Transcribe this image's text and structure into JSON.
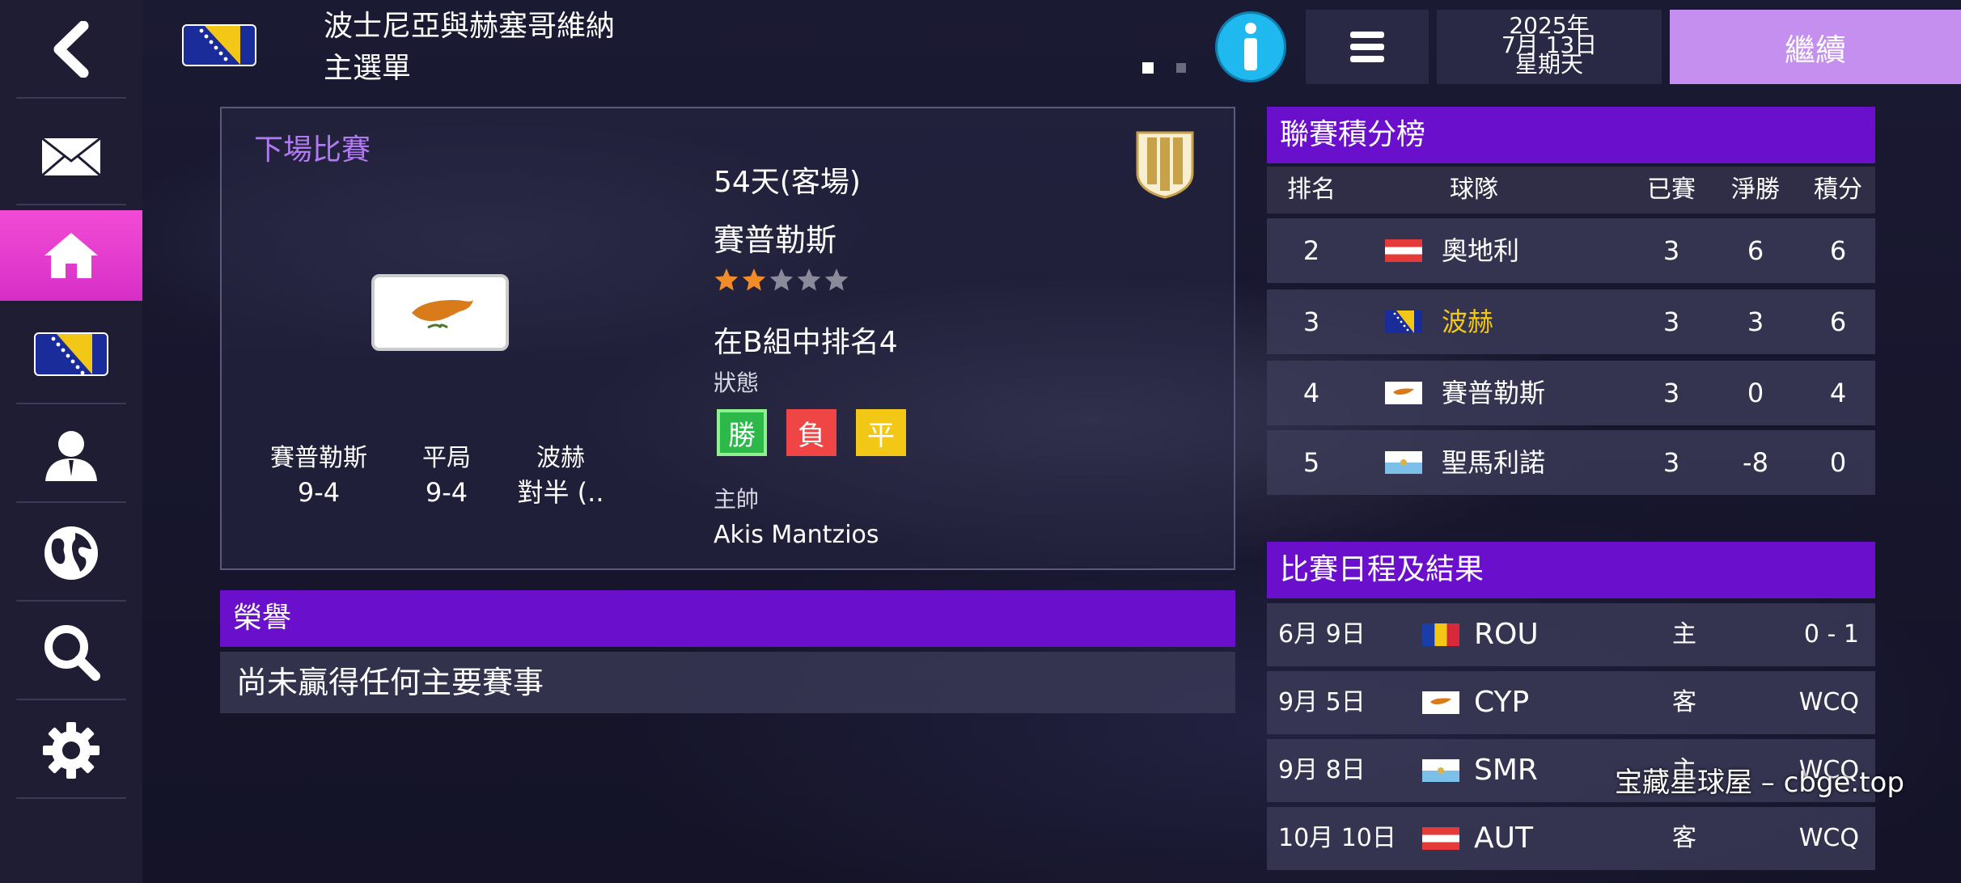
{
  "header": {
    "team_name": "波士尼亞與赫塞哥維納",
    "page_title": "主選單",
    "date_year": "2025年",
    "date_day": "7月 13日",
    "date_weekday": "星期天",
    "continue_label": "繼續"
  },
  "sidebar": {
    "items": [
      {
        "icon": "back-arrow-icon"
      },
      {
        "icon": "mail-icon"
      },
      {
        "icon": "home-icon",
        "active": true
      },
      {
        "icon": "team-flag-icon"
      },
      {
        "icon": "person-icon"
      },
      {
        "icon": "globe-icon"
      },
      {
        "icon": "search-icon"
      },
      {
        "icon": "settings-gear-icon"
      }
    ]
  },
  "next_match": {
    "title": "下場比賽",
    "round": "54天(客場)",
    "opponent": "賽普勒斯",
    "stars": 2,
    "stars_max": 5,
    "rank_text": "在B組中排名4",
    "status_label": "狀態",
    "form": [
      "勝",
      "負",
      "平"
    ],
    "coach_label": "主帥",
    "coach_name": "Akis Mantzios",
    "h2h": {
      "home_label": "賽普勒斯",
      "home_value": "9-4",
      "draw_label": "平局",
      "draw_value": "9-4",
      "away_label": "波赫",
      "away_value": "對半 (.."
    }
  },
  "honours": {
    "title": "榮譽",
    "text": "尚未贏得任何主要賽事"
  },
  "league_table": {
    "title": "聯賽積分榜",
    "columns": {
      "rank": "排名",
      "team": "球隊",
      "played": "已賽",
      "gd": "淨勝",
      "pts": "積分"
    },
    "rows": [
      {
        "rank": "2",
        "team": "奧地利",
        "played": "3",
        "gd": "6",
        "pts": "6",
        "flag": "austria",
        "highlight": false
      },
      {
        "rank": "3",
        "team": "波赫",
        "played": "3",
        "gd": "3",
        "pts": "6",
        "flag": "bosnia",
        "highlight": true
      },
      {
        "rank": "4",
        "team": "賽普勒斯",
        "played": "3",
        "gd": "0",
        "pts": "4",
        "flag": "cyprus",
        "highlight": false
      },
      {
        "rank": "5",
        "team": "聖馬利諾",
        "played": "3",
        "gd": "-8",
        "pts": "0",
        "flag": "san-marino",
        "highlight": false
      }
    ]
  },
  "fixtures": {
    "title": "比賽日程及結果",
    "rows": [
      {
        "date": "6月 9日",
        "team": "ROU",
        "venue": "主",
        "result": "0 - 1",
        "flag": "romania"
      },
      {
        "date": "9月 5日",
        "team": "CYP",
        "venue": "客",
        "result": "WCQ",
        "flag": "cyprus"
      },
      {
        "date": "9月 8日",
        "team": "SMR",
        "venue": "主",
        "result": "WCQ",
        "flag": "san-marino"
      },
      {
        "date": "10月 10日",
        "team": "AUT",
        "venue": "客",
        "result": "WCQ",
        "flag": "austria"
      }
    ]
  },
  "watermark": "宝藏星球屋 – cbge.top",
  "colors": {
    "accent_purple": "#6a0fcc",
    "active_pink": "#e83cd0",
    "continue_bg": "#c58ff0",
    "highlight_team": "#f3c716"
  }
}
